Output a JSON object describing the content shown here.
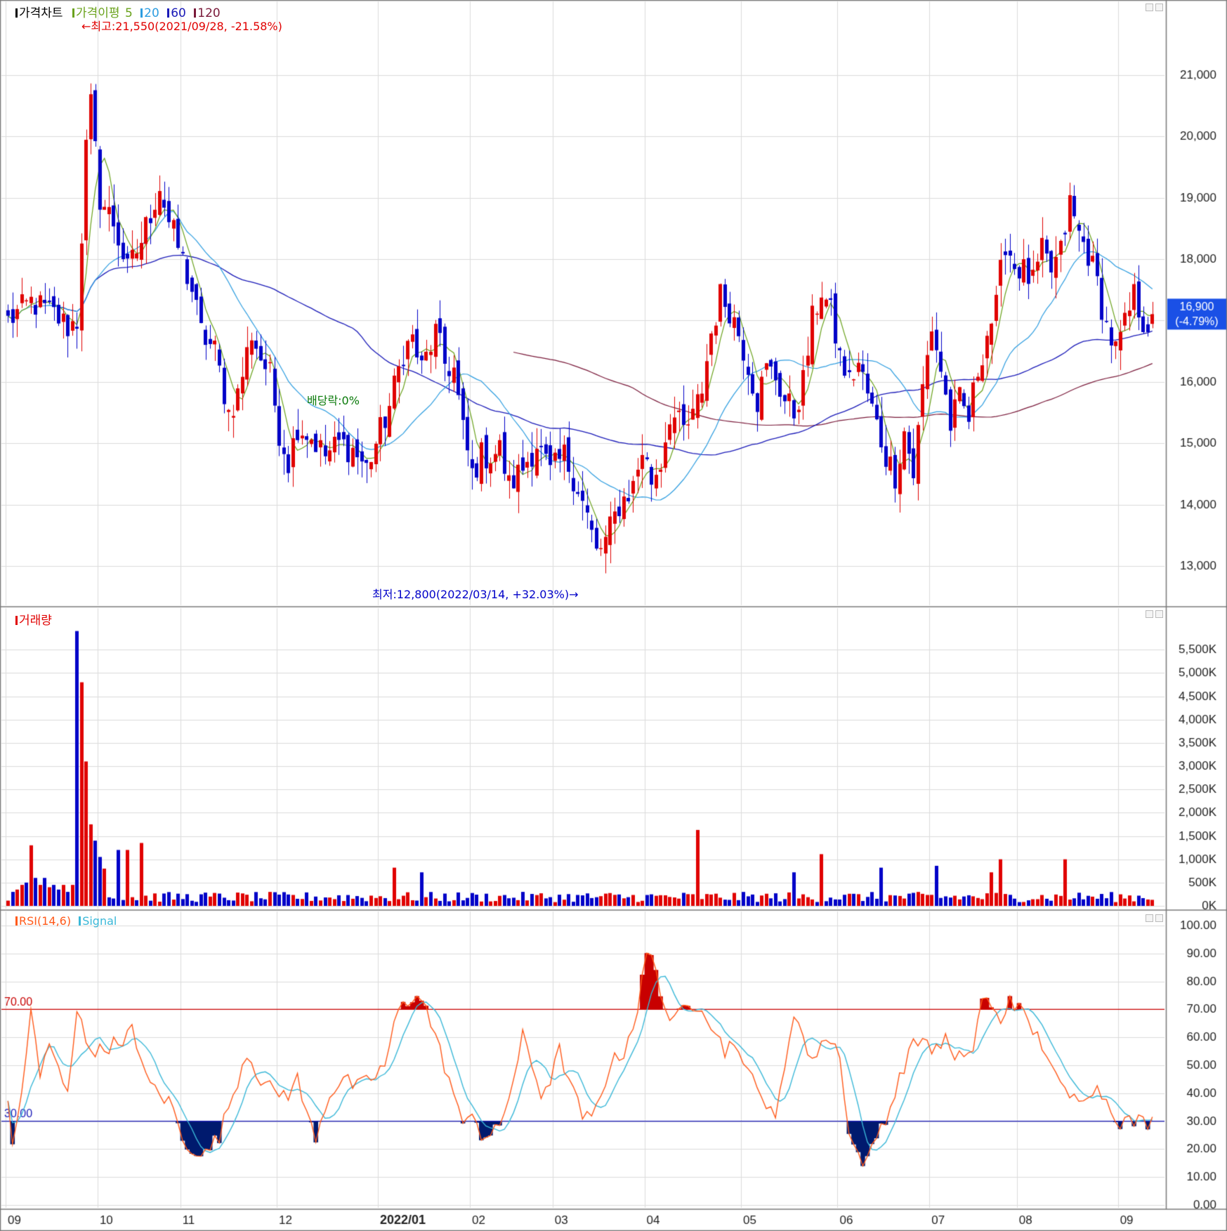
{
  "chart_data": [
    {
      "type": "candlestick",
      "panel": "price",
      "legend": {
        "title": "가격차트",
        "ma_label": "가격이평",
        "ma_periods": [
          "5",
          "20",
          "60",
          "120"
        ],
        "ma_colors": [
          "#6aa21c",
          "#2d9de0",
          "#1a1ab8",
          "#7a1a3a"
        ]
      },
      "y_ticks": [
        "21,000",
        "20,000",
        "19,000",
        "18,000",
        "17,000",
        "16,000",
        "15,000",
        "14,000",
        "13,000"
      ],
      "ylim": [
        12500,
        21900
      ],
      "annotations": {
        "high": "←최고:21,550(2021/09/28, -21.58%)",
        "low": "최저:12,800(2022/03/14, +32.03%)→",
        "dividend": "배당락:0%"
      },
      "current_price": "16,900",
      "current_change": "(-4.79%)",
      "anchors": [
        [
          0,
          17000
        ],
        [
          5,
          17300
        ],
        [
          10,
          17100
        ],
        [
          13,
          16900
        ],
        [
          15,
          17000
        ],
        [
          17,
          19800
        ],
        [
          18,
          20500
        ],
        [
          20,
          19000
        ],
        [
          23,
          18600
        ],
        [
          26,
          17800
        ],
        [
          29,
          18300
        ],
        [
          33,
          19200
        ],
        [
          35,
          18600
        ],
        [
          37,
          18200
        ],
        [
          40,
          17500
        ],
        [
          42,
          16800
        ],
        [
          45,
          16500
        ],
        [
          48,
          15500
        ],
        [
          50,
          15800
        ],
        [
          53,
          16800
        ],
        [
          55,
          16400
        ],
        [
          57,
          16100
        ],
        [
          59,
          15200
        ],
        [
          61,
          14700
        ],
        [
          63,
          15300
        ],
        [
          66,
          15100
        ],
        [
          69,
          14800
        ],
        [
          72,
          15000
        ],
        [
          75,
          14900
        ],
        [
          78,
          14600
        ],
        [
          80,
          15000
        ],
        [
          83,
          15600
        ],
        [
          86,
          16500
        ],
        [
          88,
          16700
        ],
        [
          90,
          16200
        ],
        [
          93,
          16800
        ],
        [
          95,
          16300
        ],
        [
          97,
          16200
        ],
        [
          99,
          15200
        ],
        [
          101,
          14500
        ],
        [
          103,
          14800
        ],
        [
          105,
          14800
        ],
        [
          107,
          14900
        ],
        [
          109,
          14300
        ],
        [
          112,
          14600
        ],
        [
          115,
          15000
        ],
        [
          118,
          14500
        ],
        [
          121,
          14800
        ],
        [
          124,
          14300
        ],
        [
          126,
          13800
        ],
        [
          128,
          13200
        ],
        [
          130,
          13400
        ],
        [
          133,
          14000
        ],
        [
          136,
          14300
        ],
        [
          138,
          14900
        ],
        [
          140,
          14400
        ],
        [
          142,
          14700
        ],
        [
          144,
          15500
        ],
        [
          147,
          15200
        ],
        [
          149,
          15400
        ],
        [
          151,
          15900
        ],
        [
          153,
          16800
        ],
        [
          155,
          17400
        ],
        [
          157,
          17200
        ],
        [
          159,
          16800
        ],
        [
          161,
          16300
        ],
        [
          163,
          15700
        ],
        [
          165,
          16200
        ],
        [
          167,
          16100
        ],
        [
          169,
          15700
        ],
        [
          171,
          15500
        ],
        [
          173,
          16000
        ],
        [
          175,
          17000
        ],
        [
          177,
          17500
        ],
        [
          179,
          17100
        ],
        [
          181,
          16400
        ],
        [
          183,
          16000
        ],
        [
          185,
          16300
        ],
        [
          187,
          15800
        ],
        [
          189,
          15300
        ],
        [
          191,
          14800
        ],
        [
          193,
          14500
        ],
        [
          195,
          15200
        ],
        [
          197,
          14500
        ],
        [
          199,
          15900
        ],
        [
          201,
          16900
        ],
        [
          203,
          16200
        ],
        [
          205,
          15300
        ],
        [
          207,
          15700
        ],
        [
          209,
          15400
        ],
        [
          211,
          16200
        ],
        [
          213,
          16800
        ],
        [
          215,
          17200
        ],
        [
          217,
          18300
        ],
        [
          219,
          17900
        ],
        [
          221,
          17800
        ],
        [
          223,
          17600
        ],
        [
          225,
          18100
        ],
        [
          227,
          17800
        ],
        [
          229,
          18100
        ],
        [
          231,
          18900
        ],
        [
          233,
          18400
        ],
        [
          235,
          18100
        ],
        [
          237,
          17600
        ],
        [
          239,
          16900
        ],
        [
          241,
          16500
        ],
        [
          243,
          16900
        ],
        [
          245,
          17400
        ],
        [
          247,
          17000
        ],
        [
          249,
          16900
        ]
      ]
    },
    {
      "type": "bar",
      "panel": "volume",
      "legend": {
        "title": "거래량"
      },
      "y_ticks": [
        "5,500K",
        "5,000K",
        "4,500K",
        "4,000K",
        "3,500K",
        "3,000K",
        "2,500K",
        "2,000K",
        "1,500K",
        "1,000K",
        "500K",
        "0K"
      ],
      "ylim": [
        0,
        6000000
      ],
      "spikes": [
        [
          15,
          5900000
        ],
        [
          16,
          4800000
        ],
        [
          17,
          3100000
        ],
        [
          18,
          1750000
        ],
        [
          19,
          1400000
        ],
        [
          20,
          1050000
        ],
        [
          21,
          800000
        ],
        [
          24,
          1200000
        ],
        [
          26,
          1200000
        ],
        [
          29,
          1350000
        ],
        [
          5,
          1300000
        ],
        [
          84,
          820000
        ],
        [
          90,
          720000
        ],
        [
          150,
          1630000
        ],
        [
          171,
          720000
        ],
        [
          177,
          1110000
        ],
        [
          190,
          820000
        ],
        [
          202,
          860000
        ],
        [
          214,
          720000
        ],
        [
          216,
          1000000
        ],
        [
          230,
          1000000
        ],
        [
          1,
          300000
        ],
        [
          2,
          350000
        ],
        [
          3,
          450000
        ],
        [
          4,
          500000
        ],
        [
          6,
          600000
        ],
        [
          7,
          450000
        ],
        [
          8,
          600000
        ],
        [
          9,
          400000
        ],
        [
          10,
          450000
        ],
        [
          11,
          350000
        ],
        [
          12,
          450000
        ],
        [
          13,
          300000
        ],
        [
          14,
          450000
        ]
      ]
    },
    {
      "type": "line",
      "panel": "rsi",
      "legend": {
        "title": "RSI(14,6)",
        "signal": "Signal",
        "colors": [
          "#ff5a1a",
          "#3ab8d8"
        ]
      },
      "y_ticks": [
        "100.00",
        "90.00",
        "80.00",
        "70.00",
        "60.00",
        "50.00",
        "40.00",
        "30.00",
        "20.00",
        "10.00",
        "0.00"
      ],
      "ylim": [
        0,
        100
      ],
      "levels": {
        "upper": 70,
        "lower": 30,
        "upper_label": "70.00",
        "lower_label": "30.00"
      },
      "anchors": [
        [
          0,
          38
        ],
        [
          1,
          20
        ],
        [
          3,
          40
        ],
        [
          5,
          70
        ],
        [
          7,
          45
        ],
        [
          9,
          58
        ],
        [
          11,
          48
        ],
        [
          13,
          42
        ],
        [
          15,
          70
        ],
        [
          17,
          58
        ],
        [
          20,
          55
        ],
        [
          23,
          58
        ],
        [
          25,
          55
        ],
        [
          27,
          65
        ],
        [
          30,
          45
        ],
        [
          33,
          40
        ],
        [
          36,
          35
        ],
        [
          38,
          22
        ],
        [
          41,
          20
        ],
        [
          43,
          18
        ],
        [
          46,
          25
        ],
        [
          49,
          40
        ],
        [
          52,
          55
        ],
        [
          55,
          45
        ],
        [
          58,
          40
        ],
        [
          61,
          40
        ],
        [
          63,
          45
        ],
        [
          65,
          32
        ],
        [
          67,
          25
        ],
        [
          70,
          40
        ],
        [
          73,
          45
        ],
        [
          76,
          42
        ],
        [
          79,
          45
        ],
        [
          82,
          50
        ],
        [
          85,
          70
        ],
        [
          87,
          72
        ],
        [
          89,
          77
        ],
        [
          91,
          70
        ],
        [
          94,
          55
        ],
        [
          97,
          40
        ],
        [
          99,
          27
        ],
        [
          101,
          35
        ],
        [
          103,
          25
        ],
        [
          105,
          24
        ],
        [
          107,
          28
        ],
        [
          110,
          45
        ],
        [
          112,
          60
        ],
        [
          114,
          50
        ],
        [
          116,
          40
        ],
        [
          118,
          45
        ],
        [
          120,
          55
        ],
        [
          123,
          40
        ],
        [
          125,
          32
        ],
        [
          127,
          30
        ],
        [
          129,
          40
        ],
        [
          131,
          50
        ],
        [
          134,
          55
        ],
        [
          137,
          70
        ],
        [
          139,
          90
        ],
        [
          141,
          85
        ],
        [
          143,
          70
        ],
        [
          145,
          65
        ],
        [
          147,
          70
        ],
        [
          149,
          72
        ],
        [
          151,
          72
        ],
        [
          153,
          65
        ],
        [
          156,
          55
        ],
        [
          158,
          60
        ],
        [
          160,
          48
        ],
        [
          163,
          45
        ],
        [
          165,
          35
        ],
        [
          167,
          30
        ],
        [
          169,
          50
        ],
        [
          171,
          70
        ],
        [
          173,
          60
        ],
        [
          175,
          50
        ],
        [
          177,
          60
        ],
        [
          179,
          58
        ],
        [
          181,
          55
        ],
        [
          183,
          25
        ],
        [
          185,
          18
        ],
        [
          187,
          15
        ],
        [
          189,
          25
        ],
        [
          192,
          35
        ],
        [
          194,
          45
        ],
        [
          196,
          55
        ],
        [
          199,
          60
        ],
        [
          202,
          55
        ],
        [
          204,
          60
        ],
        [
          206,
          50
        ],
        [
          208,
          55
        ],
        [
          210,
          55
        ],
        [
          212,
          75
        ],
        [
          214,
          70
        ],
        [
          216,
          65
        ],
        [
          218,
          75
        ],
        [
          220,
          70
        ],
        [
          222,
          65
        ],
        [
          224,
          60
        ],
        [
          226,
          55
        ],
        [
          228,
          45
        ],
        [
          230,
          40
        ],
        [
          232,
          38
        ],
        [
          234,
          40
        ],
        [
          236,
          42
        ],
        [
          238,
          40
        ],
        [
          240,
          35
        ],
        [
          242,
          30
        ]
      ]
    }
  ],
  "x_labels": [
    "09",
    "10",
    "11",
    "12",
    "2022/01",
    "02",
    "03",
    "04",
    "05",
    "06",
    "07",
    "08",
    "09"
  ],
  "x_label_positions": [
    0,
    20,
    38,
    59,
    81,
    101,
    119,
    139,
    160,
    181,
    201,
    220,
    242
  ],
  "colors": {
    "up": "#e00000",
    "down": "#0000c8",
    "grid": "#dcdcdc",
    "panel_border": "#7a7a7a",
    "price_box": "#1a50e6"
  }
}
